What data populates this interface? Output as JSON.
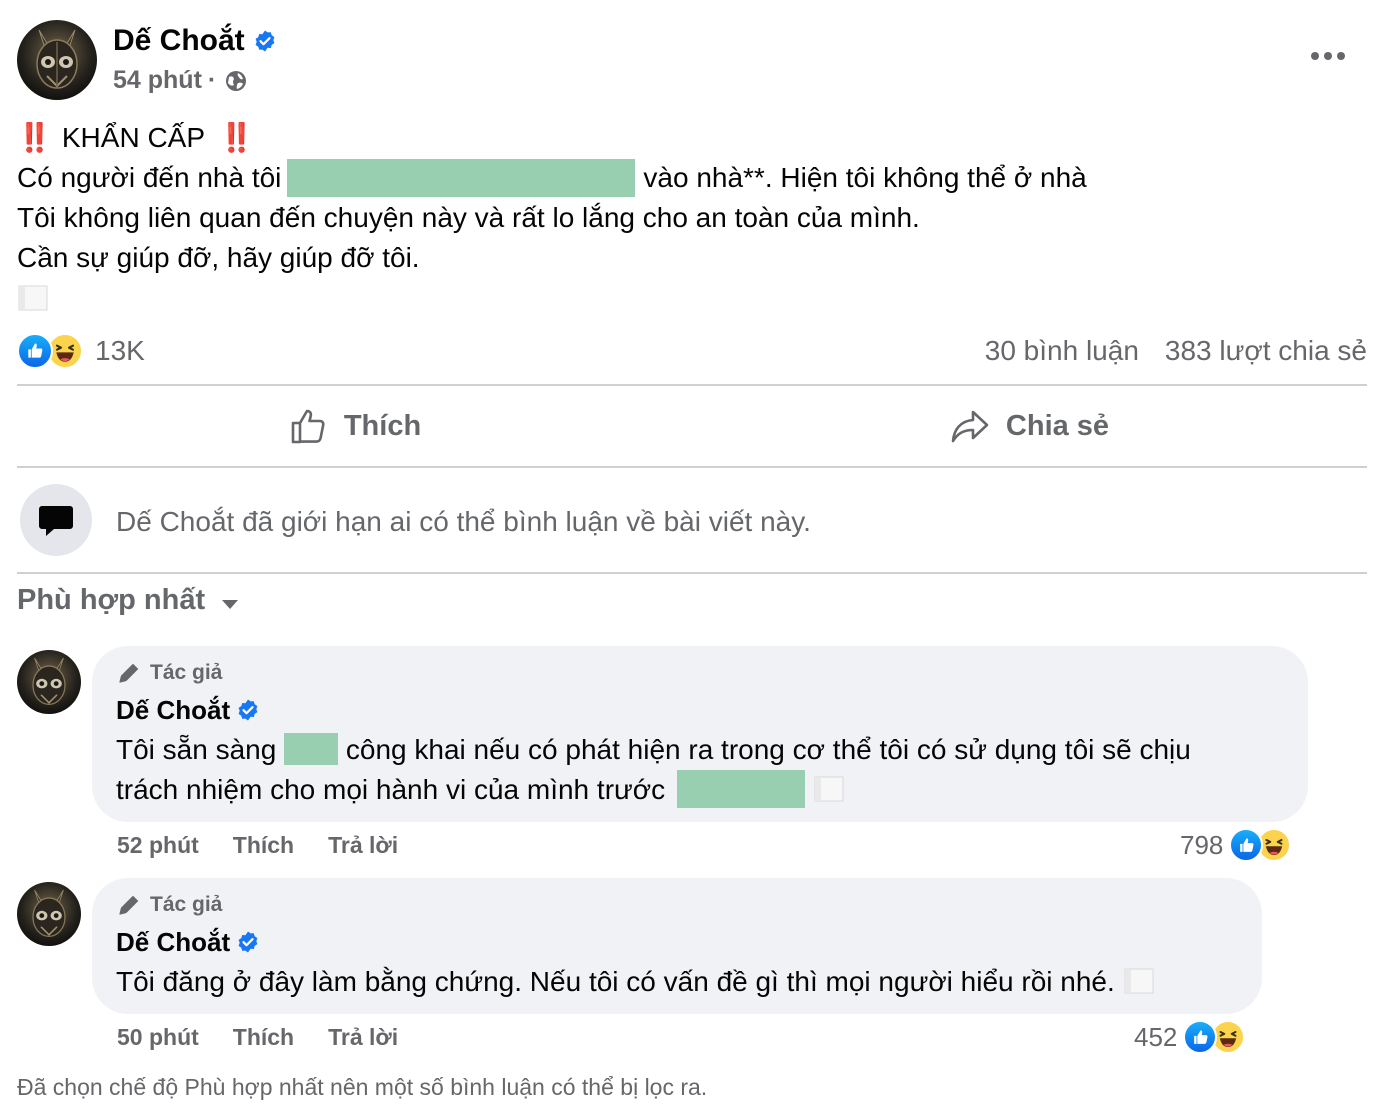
{
  "post": {
    "author": "Dế Choắt",
    "time": "54 phút",
    "time_separator": "·",
    "privacy_icon": "globe-icon",
    "more_icon": "more-horizontal-icon",
    "heading": "KHẨN CẤP",
    "heading_emoji": "‼️",
    "lines": {
      "line1_before": "Có người đến nhà tôi",
      "line1_after": "vào nhà**. Hiện tôi không thể ở nhà",
      "line2": "Tôi không liên quan đến chuyện này và rất lo lắng cho an toàn của mình.",
      "line3": "Cần sự giúp đỡ, hãy giúp đỡ tôi."
    }
  },
  "reactions": {
    "count": "13K",
    "types": [
      "like",
      "haha"
    ],
    "comments": "30 bình luận",
    "shares": "383 lượt chia sẻ"
  },
  "actions": {
    "like": "Thích",
    "share": "Chia sẻ"
  },
  "restriction": {
    "text": "Dế Choắt đã giới hạn ai có thể bình luận về bài viết này."
  },
  "sort": {
    "label": "Phù hợp nhất"
  },
  "comments": [
    {
      "tag": "Tác giả",
      "author": "Dế Choắt",
      "text_a": "Tôi sẵn sàng",
      "text_b": "công khai nếu có phát hiện ra trong cơ thể tôi có sử dụng tôi sẽ chịu",
      "text_c": "trách nhiệm cho mọi hành vi của mình trước",
      "time": "52 phút",
      "like": "Thích",
      "reply": "Trả lời",
      "reaction_count": "798"
    },
    {
      "tag": "Tác giả",
      "author": "Dế Choắt",
      "text_a": "Tôi đăng ở đây làm bằng chứng. Nếu tôi có vấn đề gì thì mọi người hiểu rồi nhé.",
      "time": "50 phút",
      "like": "Thích",
      "reply": "Trả lời",
      "reaction_count": "452"
    }
  ],
  "footer": {
    "note": "Đã chọn chế độ Phù hợp nhất nên một số bình luận có thể bị lọc ra."
  },
  "colors": {
    "text": "#050505",
    "secondary": "#65676b",
    "verified": "#1877f2",
    "redaction": "#98cfb0",
    "bubble": "#f0f2f5",
    "divider": "#ced0d4",
    "alert": "#e41e3f"
  }
}
